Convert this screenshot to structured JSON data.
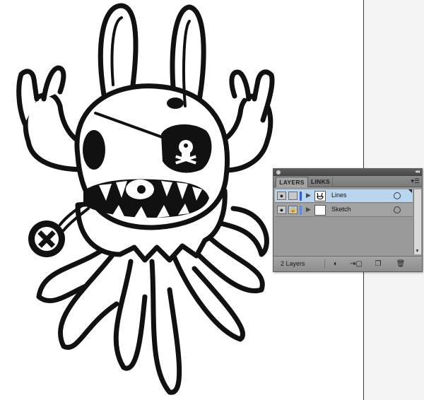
{
  "panel": {
    "tabs": [
      {
        "label": "LAYERS"
      },
      {
        "label": "LINKS"
      }
    ],
    "collapse_glyph": "◂◂",
    "menu_glyph": "▾☰",
    "layers": [
      {
        "name": "Lines",
        "selected": true,
        "visible": true,
        "locked": false,
        "color": "#3a5bd0",
        "has_thumbnail_art": true
      },
      {
        "name": "Sketch",
        "selected": false,
        "visible": true,
        "locked": true,
        "color": "#5a8fe0",
        "has_thumbnail_art": false
      }
    ],
    "layer_count_label": "2 Layers",
    "footer_icons": [
      "locate-object-icon",
      "make-clipping-mask-icon",
      "new-layer-icon",
      "delete-layer-icon"
    ]
  },
  "icons": {
    "visibility": "eye-icon",
    "lock": "lock-icon",
    "expand": "disclosure-triangle-icon",
    "target": "target-circle-icon"
  }
}
